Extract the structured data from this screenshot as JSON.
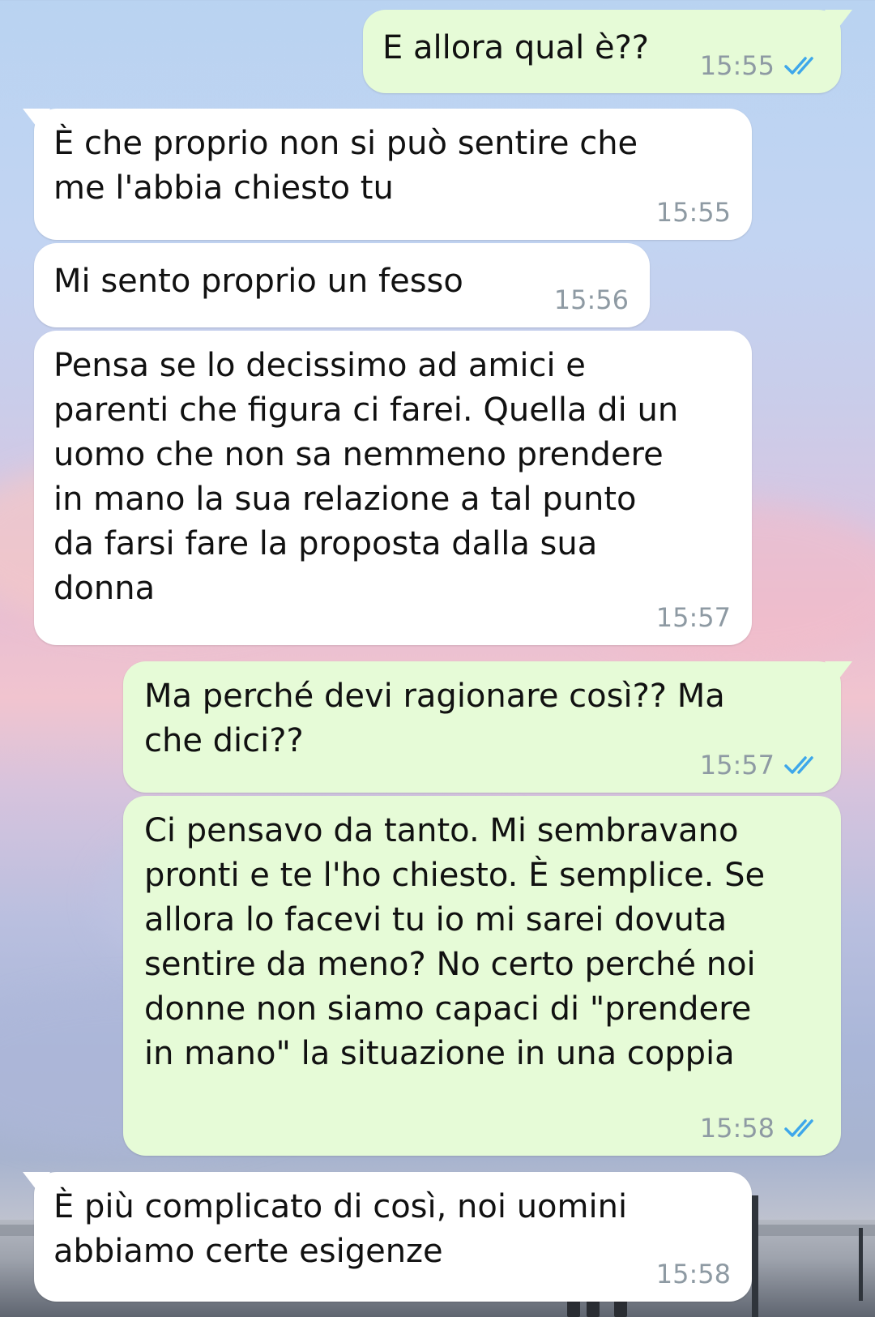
{
  "colors": {
    "incoming_bubble": "#ffffff",
    "outgoing_bubble": "#e6fbd7",
    "timestamp": "#8e9aa3",
    "read_tick": "#3ea7ea"
  },
  "messages": [
    {
      "direction": "out",
      "text": "E allora qual è??",
      "time": "15:55",
      "status_icon": "double-check-read-icon"
    },
    {
      "direction": "in",
      "text": "È che proprio non si può sentire che\nme l'abbia chiesto tu",
      "time": "15:55"
    },
    {
      "direction": "in",
      "text": "Mi sento proprio un fesso",
      "time": "15:56"
    },
    {
      "direction": "in",
      "text": "Pensa se lo decissimo ad amici e\nparenti che figura ci farei. Quella di un\nuomo che non sa nemmeno prendere\nin mano la sua relazione a tal punto\nda farsi fare la proposta dalla sua\ndonna",
      "time": "15:57"
    },
    {
      "direction": "out",
      "text": "Ma perché devi ragionare così?? Ma\nche dici??",
      "time": "15:57",
      "status_icon": "double-check-read-icon"
    },
    {
      "direction": "out",
      "text": "Ci pensavo da tanto. Mi sembravano\npronti e te l'ho chiesto. È semplice. Se\nallora lo facevi tu io mi sarei dovuta\nsentire da meno? No certo perché noi\ndonne non siamo capaci di \"prendere\nin mano\" la situazione in una coppia",
      "time": "15:58",
      "status_icon": "double-check-read-icon"
    },
    {
      "direction": "in",
      "text": "È più complicato di così, noi uomini\nabbiamo certe esigenze",
      "time": "15:58"
    }
  ]
}
